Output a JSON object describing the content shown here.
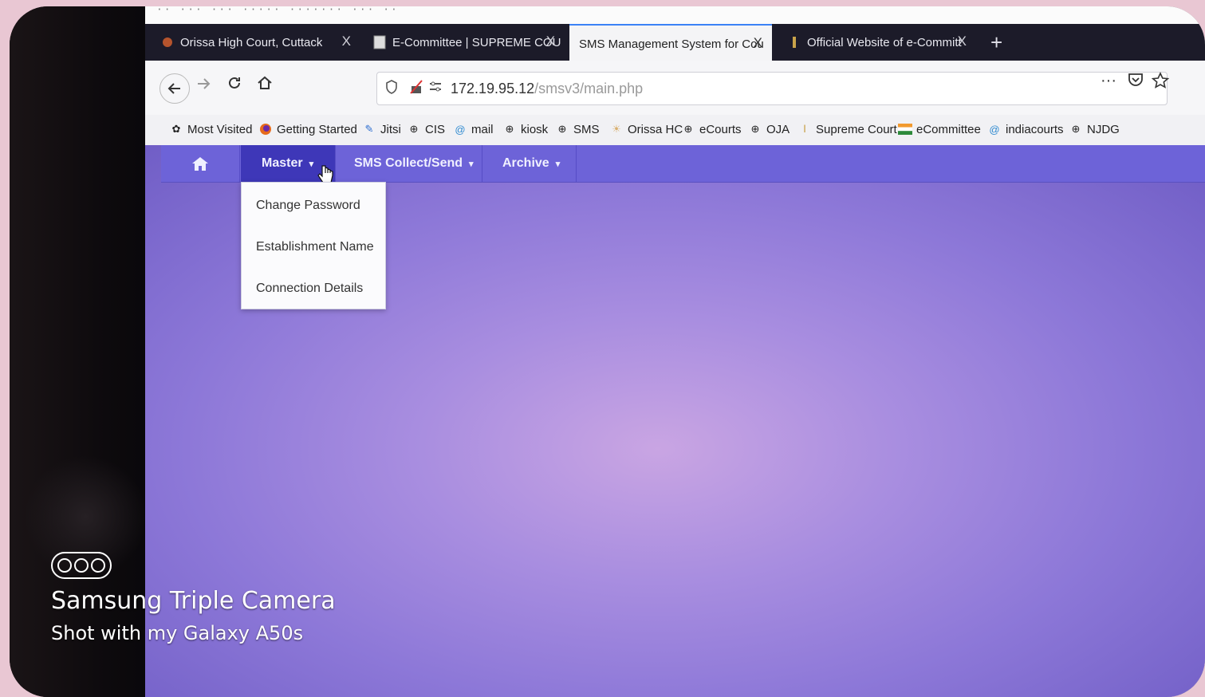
{
  "terminal_sliver": "·· ··· ··· ····· ······· ··· ··",
  "tabs": [
    {
      "title": "Orissa High Court, Cuttack",
      "icon": "court-emblem-icon",
      "active": false
    },
    {
      "title": "E-Committee | SUPREME COU",
      "icon": "document-icon",
      "active": false
    },
    {
      "title": "SMS Management System for Cou",
      "icon": "",
      "active": true
    },
    {
      "title": "Official Website of e-Committ",
      "icon": "emblem-icon",
      "active": false
    }
  ],
  "tab_close": "X",
  "new_tab": "+",
  "url": {
    "host": "172.19.95.12",
    "path": "/smsv3/main.php"
  },
  "toolbar_right": {
    "more": "···",
    "pocket": "pocket-icon",
    "star": "star-icon"
  },
  "bookmarks": [
    {
      "label": "Most Visited",
      "icon": "gear-icon"
    },
    {
      "label": "Getting Started",
      "icon": "firefox-icon"
    },
    {
      "label": "Jitsi",
      "icon": "jitsi-icon"
    },
    {
      "label": "CIS",
      "icon": "globe-icon"
    },
    {
      "label": "mail",
      "icon": "mail-icon"
    },
    {
      "label": "kiosk",
      "icon": "globe-icon"
    },
    {
      "label": "SMS",
      "icon": "globe-icon"
    },
    {
      "label": "Orissa HC",
      "icon": "court-emblem-icon"
    },
    {
      "label": "eCourts",
      "icon": "globe-icon"
    },
    {
      "label": "OJA",
      "icon": "globe-icon"
    },
    {
      "label": "Supreme Court",
      "icon": "emblem-icon"
    },
    {
      "label": "eCommittee",
      "icon": "flag-icon"
    },
    {
      "label": "indiacourts",
      "icon": "globe-icon"
    },
    {
      "label": "NJDG",
      "icon": "globe-icon"
    }
  ],
  "nav": {
    "home_icon": "home-icon",
    "master": "Master",
    "sms": "SMS Collect/Send",
    "archive": "Archive"
  },
  "dropdown": [
    "Change Password",
    "Establishment Name",
    "Connection Details"
  ],
  "watermark": {
    "line1": "Samsung Triple Camera",
    "line2": "Shot with my Galaxy A50s"
  },
  "colors": {
    "navbar": "#6d63d8",
    "nav_active": "#3e37b8",
    "tab_active_accent": "#3b82f6"
  }
}
